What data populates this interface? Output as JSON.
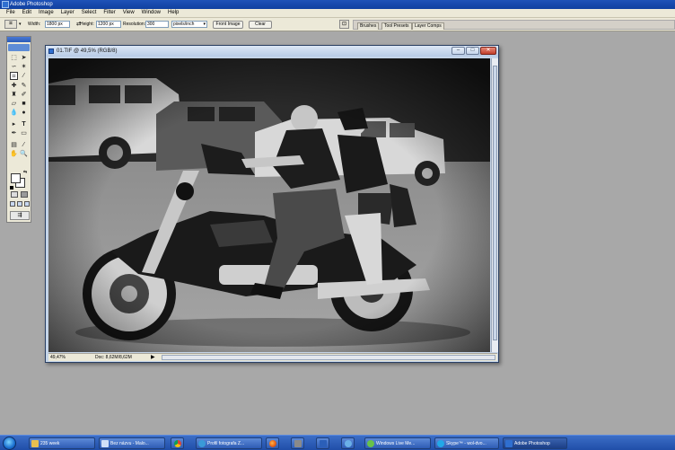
{
  "app": {
    "title": "Adobe Photoshop"
  },
  "menu": [
    "File",
    "Edit",
    "Image",
    "Layer",
    "Select",
    "Filter",
    "View",
    "Window",
    "Help"
  ],
  "options": {
    "width_label": "Width:",
    "width_value": "1800 px",
    "height_label": "Height:",
    "height_value": "1200 px",
    "resolution_label": "Resolution:",
    "resolution_value": "300",
    "unit_value": "pixels/inch",
    "front_image": "Front Image",
    "clear": "Clear"
  },
  "palette_well": {
    "tabs": [
      "Brushes",
      "Tool Presets",
      "Layer Comps"
    ]
  },
  "document": {
    "title": "01.TIF @ 49,5% (RGB/8)",
    "zoom": "49,47%",
    "doc_size": "Doc: 8,62M/8,62M",
    "photo_label": "motorcycle-couple-photo"
  },
  "taskbar": {
    "items": [
      {
        "label": "235 week",
        "icon": "folder-icon",
        "color": "#e8c050"
      },
      {
        "label": "Bez názvu - Malo...",
        "icon": "paint-icon",
        "color": "#d0e0f8"
      },
      {
        "label": "Profil fotografa Z...",
        "icon": "ie-icon",
        "color": "#3a9ad8"
      },
      {
        "label": "Windows Live Me...",
        "icon": "messenger-icon",
        "color": "#68c24a"
      },
      {
        "label": "Skype™ - wol-dvo...",
        "icon": "skype-icon",
        "color": "#22a8e8"
      },
      {
        "label": "Adobe Photoshop",
        "icon": "photoshop-icon",
        "color": "#2f6fd0"
      }
    ]
  }
}
